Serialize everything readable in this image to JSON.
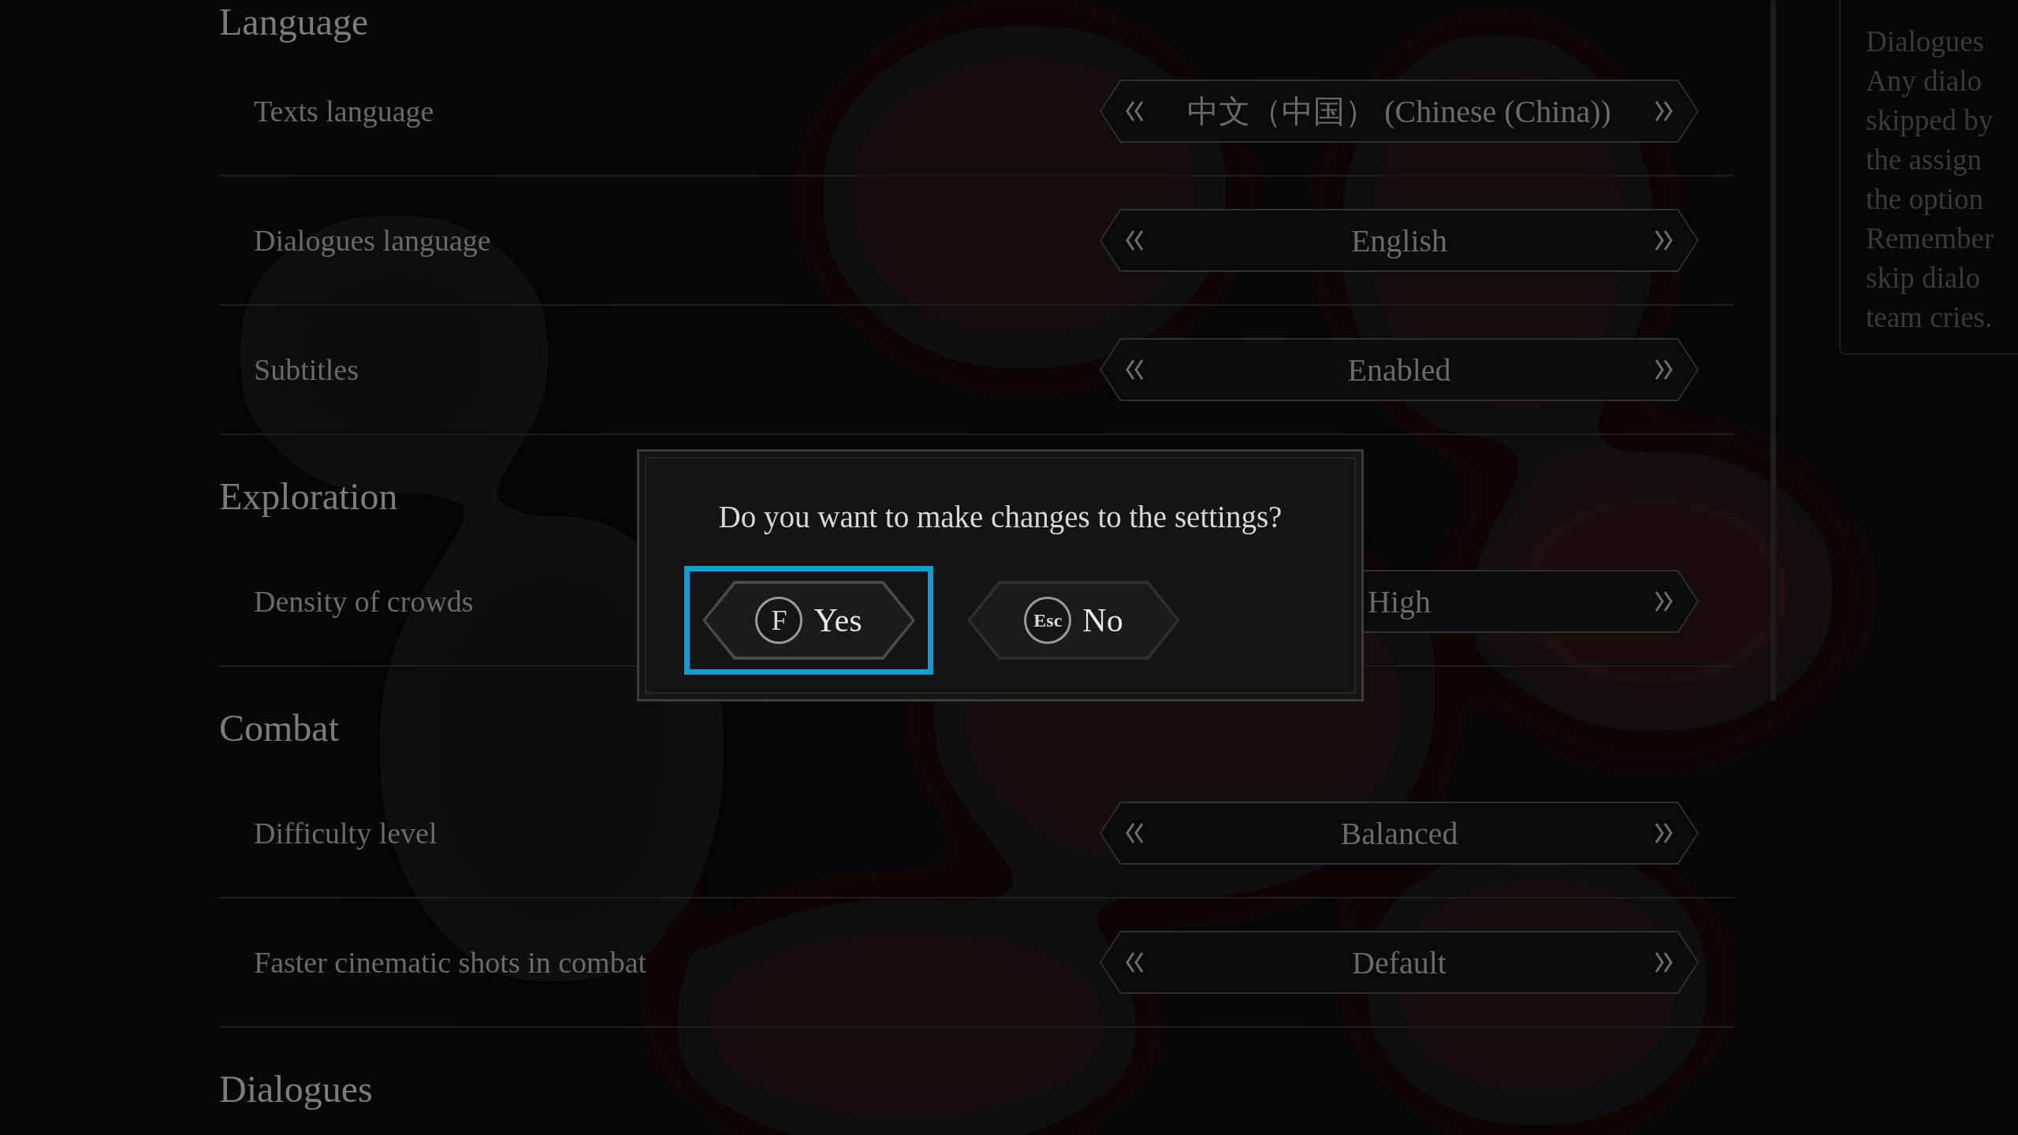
{
  "sections": [
    {
      "title": "Language",
      "rows": [
        {
          "label": "Texts language",
          "value": "中文（中国） (Chinese (China))",
          "prev_shown": true
        },
        {
          "label": "Dialogues language",
          "value": "English",
          "prev_shown": true
        },
        {
          "label": "Subtitles",
          "value": "Enabled",
          "prev_shown": true
        }
      ]
    },
    {
      "title": "Exploration",
      "rows": [
        {
          "label": "Density of crowds",
          "value": "High",
          "prev_shown": false
        }
      ]
    },
    {
      "title": "Combat",
      "rows": [
        {
          "label": "Difficulty level",
          "value": "Balanced",
          "prev_shown": true
        },
        {
          "label": "Faster cinematic shots in combat",
          "value": "Default",
          "prev_shown": true
        }
      ]
    },
    {
      "title": "Dialogues"
    }
  ],
  "help_panel": {
    "lines": [
      "Dialogues",
      "Any dialo",
      "skipped by",
      "the assign",
      "the option",
      "Remember",
      "skip dialo",
      "team cries."
    ]
  },
  "dialog": {
    "question": "Do you want to make changes to the settings?",
    "buttons": [
      {
        "key": "F",
        "label": "Yes",
        "selected": true
      },
      {
        "key": "Esc",
        "label": "No",
        "selected": false
      }
    ]
  }
}
